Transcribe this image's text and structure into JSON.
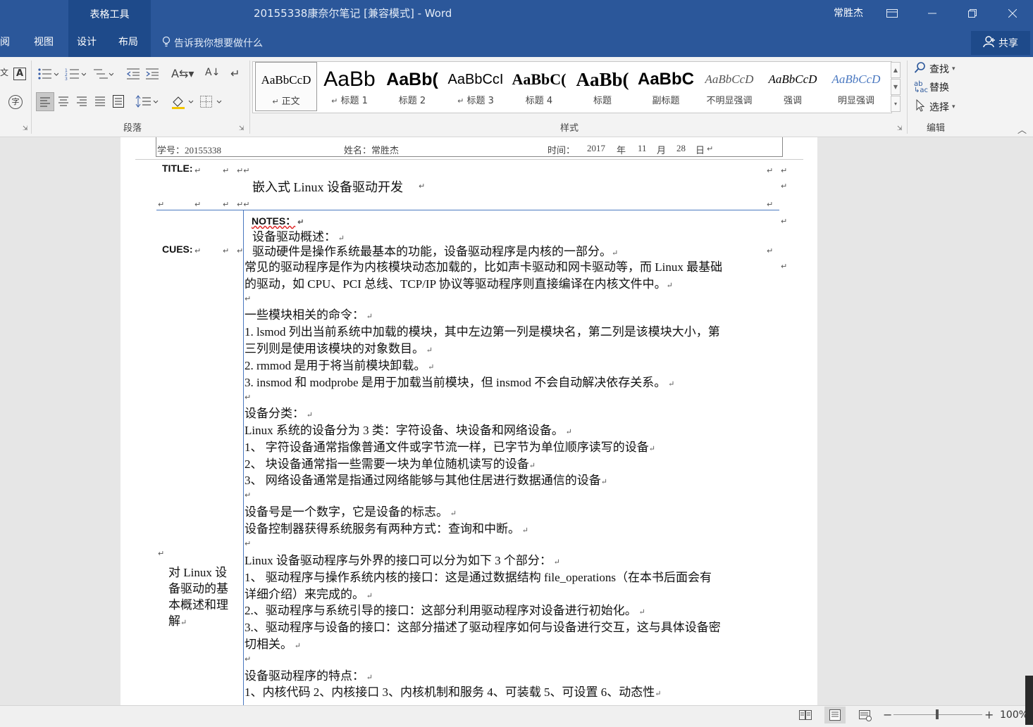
{
  "titlebar": {
    "context_tab": "表格工具",
    "doc_title": "20155338康奈尔笔记 [兼容模式]  -  Word",
    "user": "常胜杰"
  },
  "tabs": {
    "review_partial": "审阅",
    "view": "视图",
    "design": "设计",
    "layout": "布局",
    "tell_me": "告诉我你想要做什么",
    "share": "共享"
  },
  "ribbon": {
    "groups": {
      "paragraph": "段落",
      "styles": "样式",
      "editing": "编辑"
    },
    "styles": [
      {
        "sample": "AaBbCcD",
        "name": "正文"
      },
      {
        "sample": "AaBb",
        "name": "标题 1"
      },
      {
        "sample": "AaBb(",
        "name": "标题 2"
      },
      {
        "sample": "AaBbCcI",
        "name": "标题 3"
      },
      {
        "sample": "AaBbC(",
        "name": "标题 4"
      },
      {
        "sample": "AaBb(",
        "name": "标题"
      },
      {
        "sample": "AaBbC",
        "name": "副标题"
      },
      {
        "sample": "AaBbCcD",
        "name": "不明显强调"
      },
      {
        "sample": "AaBbCcD",
        "name": "强调"
      },
      {
        "sample": "AaBbCcD",
        "name": "明显强调"
      }
    ],
    "editing": {
      "find": "查找",
      "replace": "替换",
      "select": "选择"
    }
  },
  "document": {
    "header": {
      "student_id": "学号：20155338",
      "name": "姓名：常胜杰",
      "time_label": "时间：",
      "year": "2017",
      "year_unit": "年",
      "month": "11",
      "month_unit": "月",
      "day": "28",
      "day_unit": "日"
    },
    "title_label": "TITLE:",
    "title_text": "嵌入式 Linux 设备驱动开发",
    "cues_label": "CUES:",
    "notes_label": "NOTES：",
    "cues_summary": [
      "对 Linux 设",
      "备驱动的基",
      "本概述和理",
      "解"
    ],
    "notes": [
      "设备驱动概述：",
      "驱动硬件是操作系统最基本的功能，设备驱动程序是内核的一部分。",
      "常见的驱动程序是作为内核模块动态加载的，比如声卡驱动和网卡驱动等，而 Linux 最基础",
      "的驱动，如 CPU、PCI 总线、TCP/IP 协议等驱动程序则直接编译在内核文件中。",
      "一些模块相关的命令：",
      "1. lsmod 列出当前系统中加载的模块，其中左边第一列是模块名，第二列是该模块大小，第",
      "三列则是使用该模块的对象数目。",
      "2. rmmod 是用于将当前模块卸载。",
      "3. insmod 和 modprobe 是用于加载当前模块，但 insmod 不会自动解决依存关系。",
      "设备分类：",
      "Linux 系统的设备分为 3 类：字符设备、块设备和网络设备。",
      "1、 字符设备通常指像普通文件或字节流一样，已字节为单位顺序读写的设备",
      "2、 块设备通常指一些需要一块为单位随机读写的设备",
      "3、 网络设备通常是指通过网络能够与其他住居进行数据通信的设备",
      "设备号是一个数字，它是设备的标志。",
      "设备控制器获得系统服务有两种方式：查询和中断。",
      "Linux 设备驱动程序与外界的接口可以分为如下 3 个部分：",
      "1、 驱动程序与操作系统内核的接口：这是通过数据结构 file_operations（在本书后面会有",
      "详细介绍）来完成的。",
      "2.、驱动程序与系统引导的接口：这部分利用驱动程序对设备进行初始化。",
      "3.、驱动程序与设备的接口：这部分描述了驱动程序如何与设备进行交互，这与具体设备密",
      "切相关。",
      "设备驱动程序的特点：",
      "1、内核代码 2、内核接口 3、内核机制和服务 4、可装载 5、可设置 6、动态性"
    ]
  },
  "statusbar": {
    "zoom": "100%"
  },
  "colors": {
    "accent": "#2b579a",
    "accent_dark": "#1e4a8a",
    "ribbon_bg": "#f3f3f3",
    "page_bg": "#ffffff",
    "workspace_bg": "#e6e6e6"
  }
}
